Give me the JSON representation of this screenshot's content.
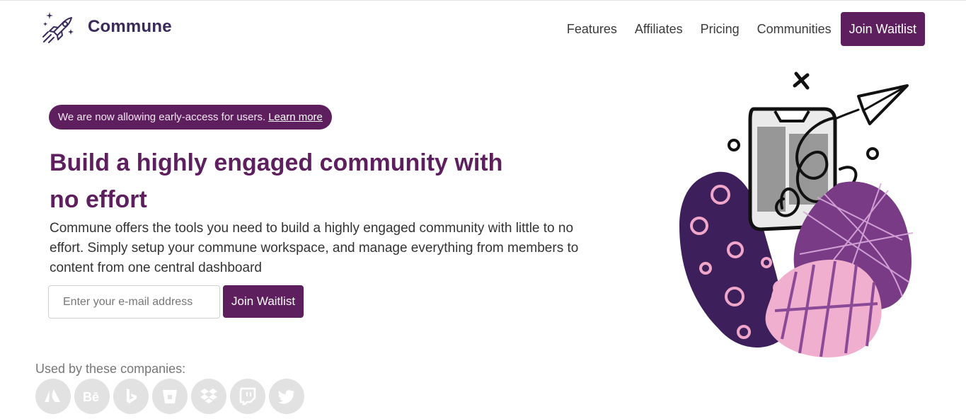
{
  "brand": {
    "name": "Commune",
    "logo_icon": "rocket-icon",
    "accent": "#5e1f5e"
  },
  "nav": {
    "items": [
      "Features",
      "Affiliates",
      "Pricing",
      "Communities"
    ],
    "cta_label": "Join Waitlist"
  },
  "hero": {
    "badge_text": "We are now allowing early-access for users.",
    "badge_link": "Learn more",
    "headline_line1": "Build a highly engaged community with",
    "headline_line2": "no effort",
    "subtext": "Commune offers the tools you need to build a highly engaged community with little to no effort. Simply setup your commune workspace, and manage everything from members to content from one central dashboard",
    "email_placeholder": "Enter your e-mail address",
    "join_button": "Join Waitlist"
  },
  "companies": {
    "label": "Used by these companies:",
    "icons": [
      "atlassian-icon",
      "behance-icon",
      "bing-icon",
      "bitbucket-icon",
      "dropbox-icon",
      "twitch-icon",
      "twitter-icon"
    ]
  }
}
